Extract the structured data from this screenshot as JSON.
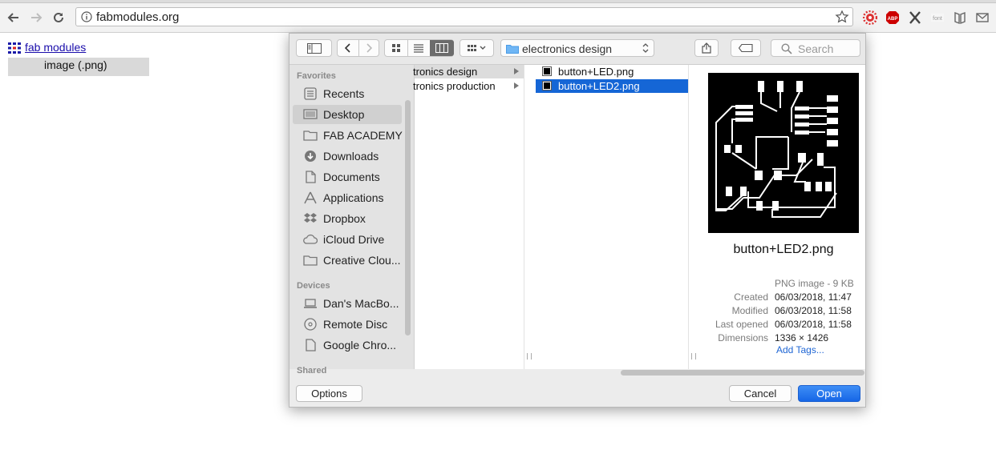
{
  "browser": {
    "url": "fabmodules.org",
    "colors": {
      "toolbar": "#f2f2f2"
    }
  },
  "page": {
    "link": "fab modules",
    "menu_item": "image (.png)"
  },
  "dialog": {
    "path_popup": "electronics design",
    "search_placeholder": "Search",
    "sidebar": {
      "favorites_header": "Favorites",
      "favorites": [
        {
          "label": "Recents",
          "icon": "recents-icon"
        },
        {
          "label": "Desktop",
          "icon": "desktop-icon"
        },
        {
          "label": "FAB ACADEMY",
          "icon": "folder-icon"
        },
        {
          "label": "Downloads",
          "icon": "downloads-icon"
        },
        {
          "label": "Documents",
          "icon": "documents-icon"
        },
        {
          "label": "Applications",
          "icon": "applications-icon"
        },
        {
          "label": "Dropbox",
          "icon": "dropbox-icon"
        },
        {
          "label": "iCloud Drive",
          "icon": "cloud-icon"
        },
        {
          "label": "Creative Clou...",
          "icon": "folder-icon"
        }
      ],
      "devices_header": "Devices",
      "devices": [
        {
          "label": "Dan's MacBo...",
          "icon": "laptop-icon"
        },
        {
          "label": "Remote Disc",
          "icon": "disc-icon"
        },
        {
          "label": "Google Chro...",
          "icon": "document-icon"
        }
      ],
      "shared_header": "Shared"
    },
    "columns": {
      "folders": [
        "tronics design",
        "tronics production"
      ],
      "files": [
        "button+LED.png",
        "button+LED2.png"
      ]
    },
    "preview": {
      "name": "button+LED2.png",
      "kind": "PNG image - 9 KB",
      "meta": [
        {
          "key": "Created",
          "value": "06/03/2018, 11:47"
        },
        {
          "key": "Modified",
          "value": "06/03/2018, 11:58"
        },
        {
          "key": "Last opened",
          "value": "06/03/2018, 11:58"
        },
        {
          "key": "Dimensions",
          "value": "1336 × 1426"
        }
      ],
      "add_tags": "Add Tags..."
    },
    "buttons": {
      "options": "Options",
      "cancel": "Cancel",
      "open": "Open"
    },
    "colors": {
      "selection": "#1566d6",
      "primary_button": "#1f6feb"
    }
  }
}
